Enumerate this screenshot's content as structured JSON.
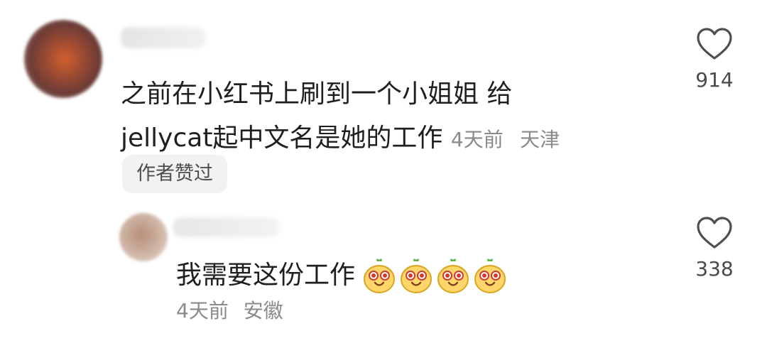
{
  "comment": {
    "text_line1": "之前在小红书上刷到一个小姐姐 给",
    "text_line2": "jellycat起中文名是她的工作",
    "time": "4天前",
    "location": "天津",
    "author_liked_badge": "作者赞过",
    "like_icon": "heart-outline-icon",
    "like_count": "914"
  },
  "reply": {
    "text": "我需要这份工作",
    "emojis": [
      "pear-face-emoji",
      "pear-face-emoji",
      "pear-face-emoji",
      "pear-face-emoji"
    ],
    "time": "4天前",
    "location": "安徽",
    "like_icon": "heart-outline-icon",
    "like_count": "338"
  }
}
